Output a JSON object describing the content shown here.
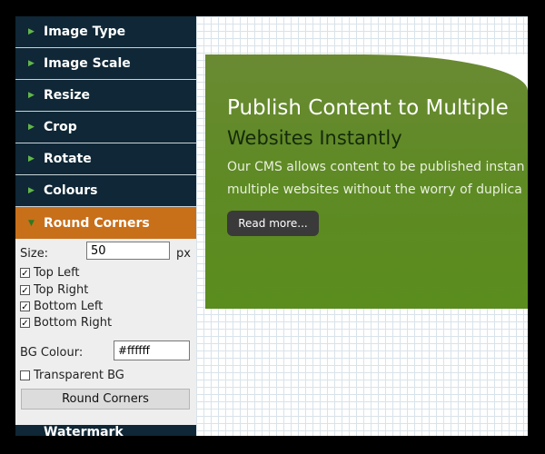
{
  "sidebar": {
    "items": [
      {
        "label": "Image Type"
      },
      {
        "label": "Image Scale"
      },
      {
        "label": "Resize"
      },
      {
        "label": "Crop"
      },
      {
        "label": "Rotate"
      },
      {
        "label": "Colours"
      },
      {
        "label": "Round Corners"
      }
    ],
    "next_item_label": "Watermark"
  },
  "round_corners": {
    "size_label": "Size:",
    "size_value": "50",
    "size_unit": "px",
    "corners": [
      {
        "label": "Top Left",
        "checked": true
      },
      {
        "label": "Top Right",
        "checked": true
      },
      {
        "label": "Bottom Left",
        "checked": true
      },
      {
        "label": "Bottom Right",
        "checked": true
      }
    ],
    "bg_colour_label": "BG Colour:",
    "bg_colour_value": "#ffffff",
    "transparent_label": "Transparent BG",
    "transparent_checked": false,
    "button_label": "Round Corners"
  },
  "preview": {
    "headline1": "Publish Content to Multiple",
    "headline2": "Websites Instantly",
    "body_line1": "Our CMS allows content to be published instan",
    "body_line2": "multiple websites without the worry of duplica",
    "read_more": "Read more..."
  },
  "colors": {
    "nav_bg": "#0f2736",
    "active_bg": "#c86f1a",
    "arrow_green": "#63b64a",
    "banner_green": "#5f8a25"
  },
  "icons": {
    "nav_arrow": "triangle-right-icon",
    "active_arrow": "triangle-down-icon",
    "checkbox": "check-icon"
  }
}
